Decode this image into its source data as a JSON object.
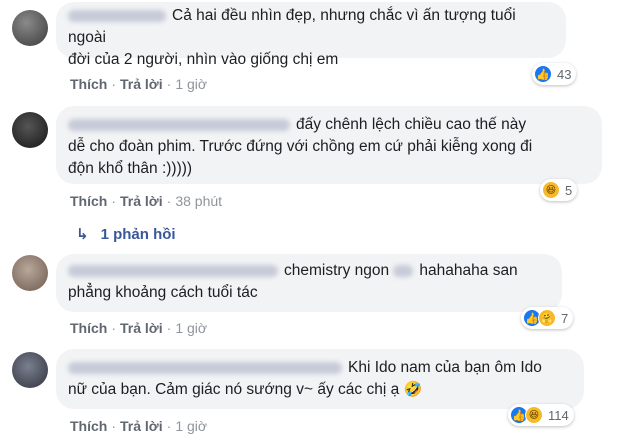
{
  "comments": [
    {
      "text_line1": "Cả hai đều nhìn đẹp, nhưng chắc vì ấn tượng tuổi ngoài",
      "text_line2": "đời của 2 người, nhìn vào giống chị em",
      "like": "Thích",
      "reply": "Trả lời",
      "time": "1 giờ",
      "reaction_count": "43",
      "reaction_icons": [
        "like-icon"
      ]
    },
    {
      "text_line1": "đấy chênh lệch chiều cao thế này",
      "text_line2": "dễ cho đoàn phim. Trước đứng với chồng em cứ phải kiễng xong đi",
      "text_line3": "độn khổ thân :)))))",
      "like": "Thích",
      "reply": "Trả lời",
      "time": "38 phút",
      "reaction_count": "5",
      "reaction_icons": [
        "haha-icon"
      ]
    },
    {
      "text_line1": "chemistry ngon",
      "text_line1b": "hahahaha san",
      "text_line2": "phẳng khoảng cách tuổi tác",
      "like": "Thích",
      "reply": "Trả lời",
      "time": "1 giờ",
      "reaction_count": "7",
      "reaction_icons": [
        "like-icon",
        "care-icon"
      ]
    },
    {
      "text_line1": "Khi Ido nam của bạn ôm Ido",
      "text_line2": "nữ của bạn. Cảm giác nó sướng v~ ấy các chị ạ",
      "emoji": "🤣",
      "like": "Thích",
      "reply": "Trả lời",
      "time": "1 giờ",
      "reaction_count": "114",
      "reaction_icons": [
        "like-icon",
        "haha-icon"
      ]
    }
  ],
  "replies_link": "1 phản hồi",
  "colors": {
    "bubble": "#f2f3f5",
    "link": "#385898",
    "like_blue": "#1877f2",
    "haha_yellow": "#f7b928"
  }
}
